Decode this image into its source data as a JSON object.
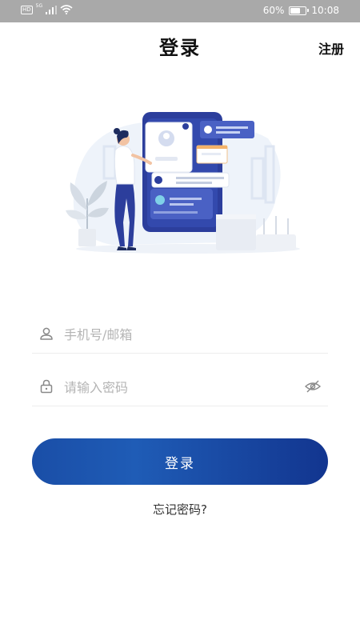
{
  "status_bar": {
    "hd_badge": "HD",
    "signal_label": "5G",
    "battery_percent": "60%",
    "battery_level": 0.6,
    "time": "10:08"
  },
  "header": {
    "title": "登录",
    "register_label": "注册"
  },
  "form": {
    "phone_placeholder": "手机号/邮箱",
    "phone_value": "",
    "password_placeholder": "请输入密码",
    "password_value": ""
  },
  "login_button_label": "登录",
  "forgot_password_label": "忘记密码?",
  "colors": {
    "status_bar_bg": "#a9a9a9",
    "button_gradient_start": "#1a4ea7",
    "button_gradient_end": "#12358f",
    "illustration_navy": "#2c3e9c"
  },
  "icons": {
    "phone_field": "user-icon",
    "password_field": "lock-icon",
    "visibility_toggle": "eye-off-icon"
  }
}
